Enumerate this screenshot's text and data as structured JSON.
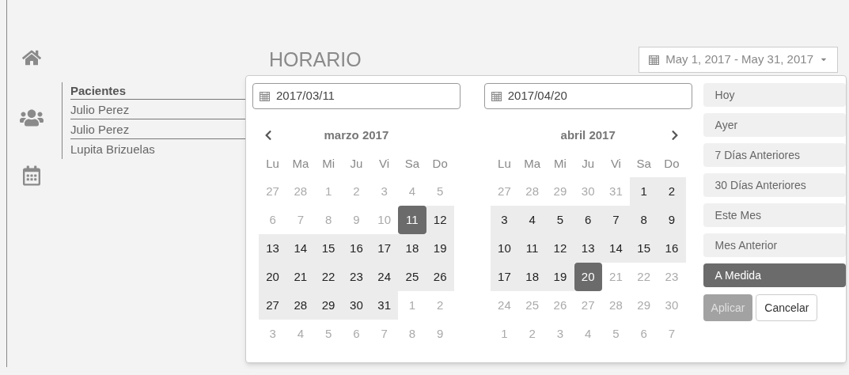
{
  "title": "HORARIO",
  "date_range_button": {
    "label": "May 1, 2017 - May 31, 2017"
  },
  "patients": {
    "heading": "Pacientes",
    "items": [
      "Julio Perez",
      "Julio Perez",
      "Lupita Brizuelas"
    ]
  },
  "calendars": [
    {
      "input_value": "2017/03/11",
      "month": "marzo 2017",
      "prev_button": true,
      "next_button": false,
      "weekdays": [
        "Lu",
        "Ma",
        "Mi",
        "Ju",
        "Vi",
        "Sa",
        "Do"
      ],
      "weeks": [
        [
          {
            "label": "27",
            "in_range": false,
            "selected": false
          },
          {
            "label": "28",
            "in_range": false,
            "selected": false
          },
          {
            "label": "1",
            "in_range": false,
            "selected": false
          },
          {
            "label": "2",
            "in_range": false,
            "selected": false
          },
          {
            "label": "3",
            "in_range": false,
            "selected": false
          },
          {
            "label": "4",
            "in_range": false,
            "selected": false
          },
          {
            "label": "5",
            "in_range": false,
            "selected": false
          }
        ],
        [
          {
            "label": "6",
            "in_range": false,
            "selected": false
          },
          {
            "label": "7",
            "in_range": false,
            "selected": false
          },
          {
            "label": "8",
            "in_range": false,
            "selected": false
          },
          {
            "label": "9",
            "in_range": false,
            "selected": false
          },
          {
            "label": "10",
            "in_range": false,
            "selected": false
          },
          {
            "label": "11",
            "in_range": true,
            "selected": true
          },
          {
            "label": "12",
            "in_range": true,
            "selected": false
          }
        ],
        [
          {
            "label": "13",
            "in_range": true,
            "selected": false
          },
          {
            "label": "14",
            "in_range": true,
            "selected": false
          },
          {
            "label": "15",
            "in_range": true,
            "selected": false
          },
          {
            "label": "16",
            "in_range": true,
            "selected": false
          },
          {
            "label": "17",
            "in_range": true,
            "selected": false
          },
          {
            "label": "18",
            "in_range": true,
            "selected": false
          },
          {
            "label": "19",
            "in_range": true,
            "selected": false
          }
        ],
        [
          {
            "label": "20",
            "in_range": true,
            "selected": false
          },
          {
            "label": "21",
            "in_range": true,
            "selected": false
          },
          {
            "label": "22",
            "in_range": true,
            "selected": false
          },
          {
            "label": "23",
            "in_range": true,
            "selected": false
          },
          {
            "label": "24",
            "in_range": true,
            "selected": false
          },
          {
            "label": "25",
            "in_range": true,
            "selected": false
          },
          {
            "label": "26",
            "in_range": true,
            "selected": false
          }
        ],
        [
          {
            "label": "27",
            "in_range": true,
            "selected": false
          },
          {
            "label": "28",
            "in_range": true,
            "selected": false
          },
          {
            "label": "29",
            "in_range": true,
            "selected": false
          },
          {
            "label": "30",
            "in_range": true,
            "selected": false
          },
          {
            "label": "31",
            "in_range": true,
            "selected": false
          },
          {
            "label": "1",
            "in_range": false,
            "selected": false
          },
          {
            "label": "2",
            "in_range": false,
            "selected": false
          }
        ],
        [
          {
            "label": "3",
            "in_range": false,
            "selected": false
          },
          {
            "label": "4",
            "in_range": false,
            "selected": false
          },
          {
            "label": "5",
            "in_range": false,
            "selected": false
          },
          {
            "label": "6",
            "in_range": false,
            "selected": false
          },
          {
            "label": "7",
            "in_range": false,
            "selected": false
          },
          {
            "label": "8",
            "in_range": false,
            "selected": false
          },
          {
            "label": "9",
            "in_range": false,
            "selected": false
          }
        ]
      ]
    },
    {
      "input_value": "2017/04/20",
      "month": "abril 2017",
      "prev_button": false,
      "next_button": true,
      "weekdays": [
        "Lu",
        "Ma",
        "Mi",
        "Ju",
        "Vi",
        "Sa",
        "Do"
      ],
      "weeks": [
        [
          {
            "label": "27",
            "in_range": false,
            "selected": false
          },
          {
            "label": "28",
            "in_range": false,
            "selected": false
          },
          {
            "label": "29",
            "in_range": false,
            "selected": false
          },
          {
            "label": "30",
            "in_range": false,
            "selected": false
          },
          {
            "label": "31",
            "in_range": false,
            "selected": false
          },
          {
            "label": "1",
            "in_range": true,
            "selected": false
          },
          {
            "label": "2",
            "in_range": true,
            "selected": false
          }
        ],
        [
          {
            "label": "3",
            "in_range": true,
            "selected": false
          },
          {
            "label": "4",
            "in_range": true,
            "selected": false
          },
          {
            "label": "5",
            "in_range": true,
            "selected": false
          },
          {
            "label": "6",
            "in_range": true,
            "selected": false
          },
          {
            "label": "7",
            "in_range": true,
            "selected": false
          },
          {
            "label": "8",
            "in_range": true,
            "selected": false
          },
          {
            "label": "9",
            "in_range": true,
            "selected": false
          }
        ],
        [
          {
            "label": "10",
            "in_range": true,
            "selected": false
          },
          {
            "label": "11",
            "in_range": true,
            "selected": false
          },
          {
            "label": "12",
            "in_range": true,
            "selected": false
          },
          {
            "label": "13",
            "in_range": true,
            "selected": false
          },
          {
            "label": "14",
            "in_range": true,
            "selected": false
          },
          {
            "label": "15",
            "in_range": true,
            "selected": false
          },
          {
            "label": "16",
            "in_range": true,
            "selected": false
          }
        ],
        [
          {
            "label": "17",
            "in_range": true,
            "selected": false
          },
          {
            "label": "18",
            "in_range": true,
            "selected": false
          },
          {
            "label": "19",
            "in_range": true,
            "selected": false
          },
          {
            "label": "20",
            "in_range": true,
            "selected": true
          },
          {
            "label": "21",
            "in_range": false,
            "selected": false
          },
          {
            "label": "22",
            "in_range": false,
            "selected": false
          },
          {
            "label": "23",
            "in_range": false,
            "selected": false
          }
        ],
        [
          {
            "label": "24",
            "in_range": false,
            "selected": false
          },
          {
            "label": "25",
            "in_range": false,
            "selected": false
          },
          {
            "label": "26",
            "in_range": false,
            "selected": false
          },
          {
            "label": "27",
            "in_range": false,
            "selected": false
          },
          {
            "label": "28",
            "in_range": false,
            "selected": false
          },
          {
            "label": "29",
            "in_range": false,
            "selected": false
          },
          {
            "label": "30",
            "in_range": false,
            "selected": false
          }
        ],
        [
          {
            "label": "1",
            "in_range": false,
            "selected": false
          },
          {
            "label": "2",
            "in_range": false,
            "selected": false
          },
          {
            "label": "3",
            "in_range": false,
            "selected": false
          },
          {
            "label": "4",
            "in_range": false,
            "selected": false
          },
          {
            "label": "5",
            "in_range": false,
            "selected": false
          },
          {
            "label": "6",
            "in_range": false,
            "selected": false
          },
          {
            "label": "7",
            "in_range": false,
            "selected": false
          }
        ]
      ]
    }
  ],
  "ranges": [
    {
      "label": "Hoy",
      "selected": false
    },
    {
      "label": "Ayer",
      "selected": false
    },
    {
      "label": "7 Días Anteriores",
      "selected": false
    },
    {
      "label": "30 Días Anteriores",
      "selected": false
    },
    {
      "label": "Este Mes",
      "selected": false
    },
    {
      "label": "Mes Anterior",
      "selected": false
    },
    {
      "label": "A Medida",
      "selected": true
    }
  ],
  "buttons": [
    {
      "label": "Aplicar",
      "kind": "apply",
      "disabled": true
    },
    {
      "label": "Cancelar",
      "kind": "cancel",
      "disabled": false
    }
  ]
}
